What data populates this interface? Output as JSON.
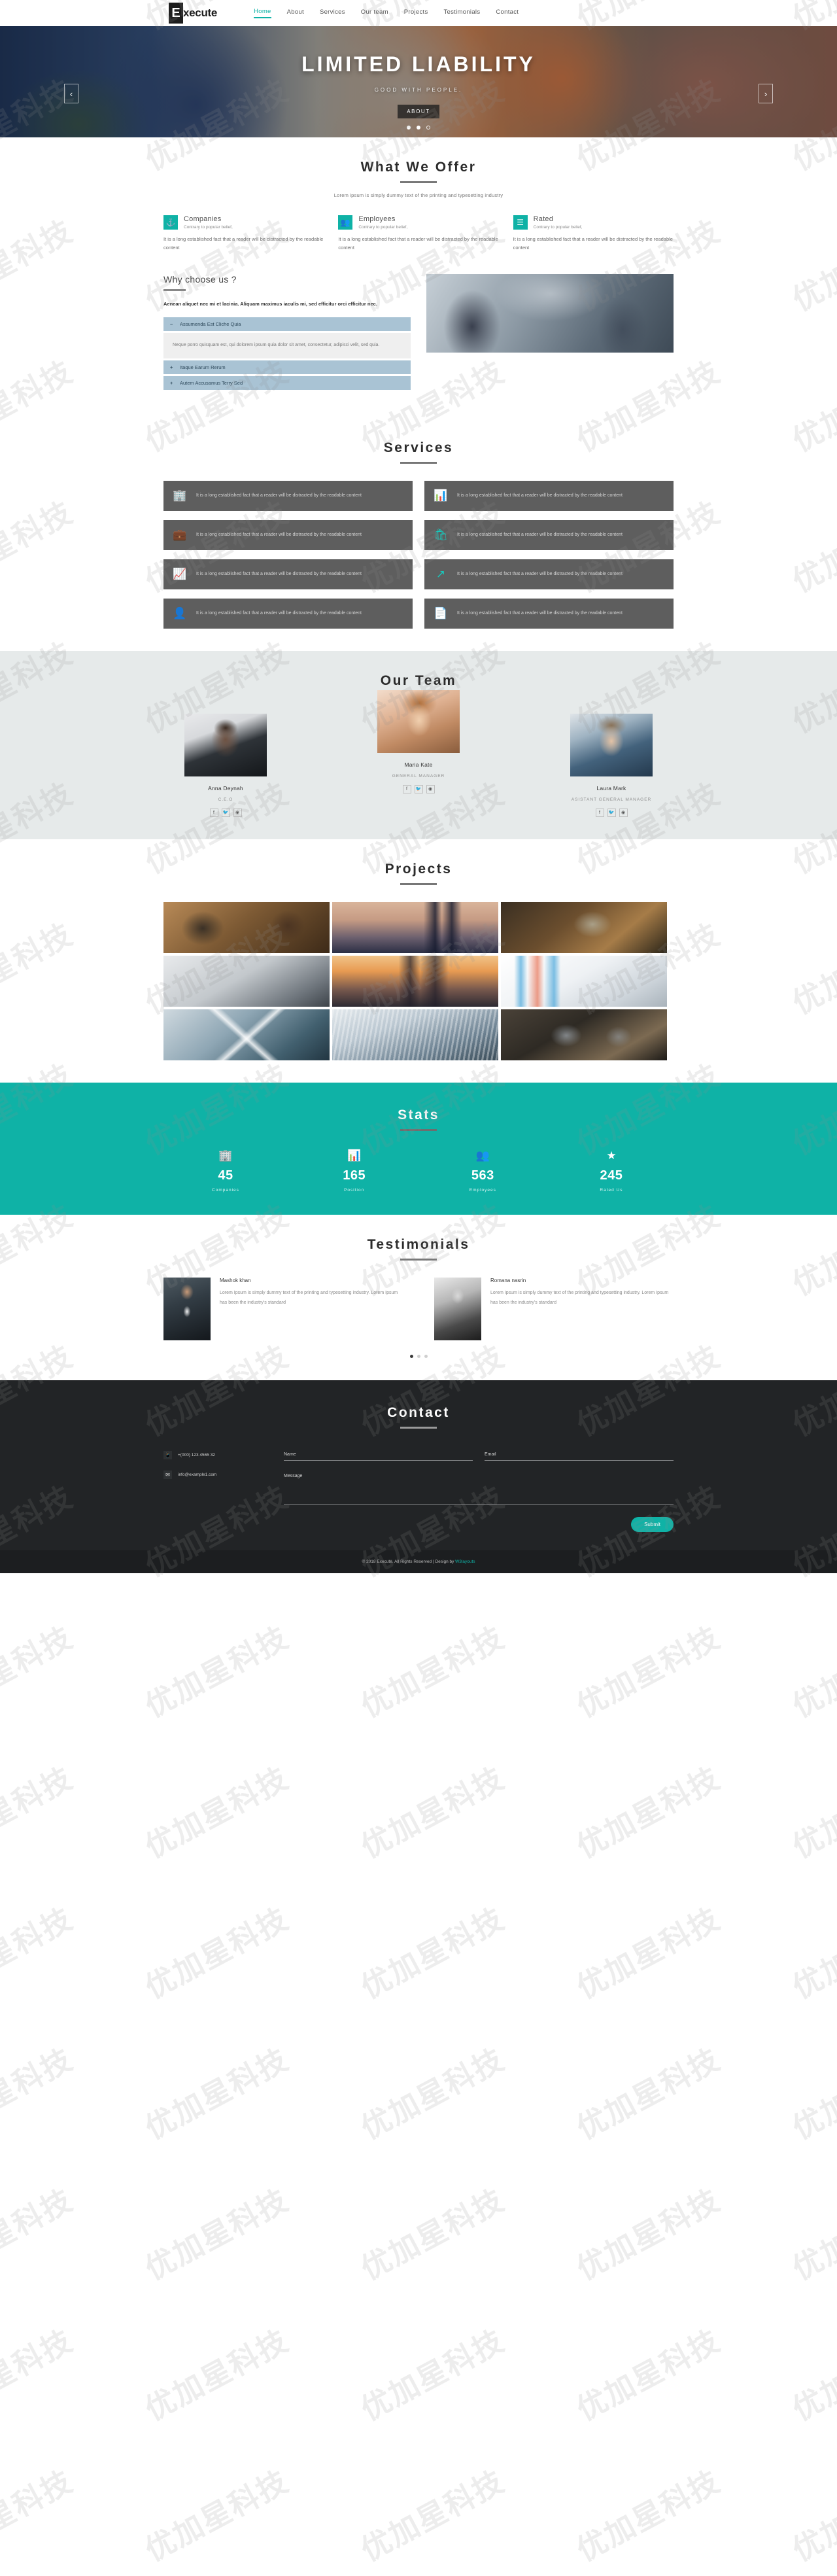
{
  "brand": {
    "logo_letter": "E",
    "logo_rest": "xecute"
  },
  "accent": "#0fb2a6",
  "nav": {
    "items": [
      {
        "label": "Home",
        "active": true
      },
      {
        "label": "About",
        "active": false
      },
      {
        "label": "Services",
        "active": false
      },
      {
        "label": "Our team",
        "active": false
      },
      {
        "label": "Projects",
        "active": false
      },
      {
        "label": "Testimonials",
        "active": false
      },
      {
        "label": "Contact",
        "active": false
      }
    ]
  },
  "hero": {
    "title": "LIMITED LIABILITY",
    "subtitle": "GOOD WITH PEOPLE.",
    "button": "ABOUT",
    "prev_icon": "chevron-left-icon",
    "next_icon": "chevron-right-icon",
    "slides": 3,
    "active_slide": 3
  },
  "offer": {
    "title": "What We Offer",
    "desc": "Lorem ipsum is simply dummy text of the printing and typesetting industry",
    "cards": [
      {
        "icon": "anchor-icon",
        "glyph": "⚓",
        "heading": "Companies",
        "sub": "Contrary to popular belief,",
        "body": "It is a long established fact that a reader will be distracted by the readable content"
      },
      {
        "icon": "users-group-icon",
        "glyph": "὆5",
        "heading": "Employees",
        "sub": "Contrary to popular belief,",
        "body": "It is a long established fact that a reader will be distracted by the readable content"
      },
      {
        "icon": "clipboard-list-icon",
        "glyph": "☰",
        "heading": "Rated",
        "sub": "Contrary to popular belief,",
        "body": "It is a long established fact that a reader will be distracted by the readable content"
      }
    ]
  },
  "why": {
    "title": "Why choose us ?",
    "lead": "Aenean aliquet nec mi et lacinia. Aliquam maximus iaculis mi, sed efficitur orci efficitur nec.",
    "accordion": [
      {
        "sign": "−",
        "label": "Assumenda Est Cliche Quia",
        "open": true,
        "body": "Neque porro quisquam est, qui dolorem ipsum quia dolor sit amet, consectetur, adipisci velit, sed quia."
      },
      {
        "sign": "+",
        "label": "Itaque Earum Rerum",
        "open": false,
        "body": ""
      },
      {
        "sign": "+",
        "label": "Autem Accusamus Terry Sed",
        "open": false,
        "body": ""
      }
    ]
  },
  "services": {
    "title": "Services",
    "cards": [
      {
        "icon": "building-icon",
        "glyph": "Ἶ2",
        "text": "It is a long established fact that a reader will be distracted by the readable content"
      },
      {
        "icon": "bar-chart-icon",
        "glyph": "ὌA",
        "text": "It is a long established fact that a reader will be distracted by the readable content"
      },
      {
        "icon": "briefcase-icon",
        "glyph": "ὋC",
        "text": "It is a long established fact that a reader will be distracted by the readable content"
      },
      {
        "icon": "shopping-bag-icon",
        "glyph": "ὬD",
        "text": "It is a long established fact that a reader will be distracted by the readable content"
      },
      {
        "icon": "line-chart-icon",
        "glyph": "Ὄ8",
        "text": "It is a long established fact that a reader will be distracted by the readable content"
      },
      {
        "icon": "external-link-icon",
        "glyph": "↗",
        "text": "It is a long established fact that a reader will be distracted by the readable content"
      },
      {
        "icon": "user-icon",
        "glyph": "὆4",
        "text": "It is a long established fact that a reader will be distracted by the readable content"
      },
      {
        "icon": "document-icon",
        "glyph": "Ὄ4",
        "text": "It is a long established fact that a reader will be distracted by the readable content"
      }
    ]
  },
  "team": {
    "title": "Our Team",
    "members": [
      {
        "name": "Anna Deynah",
        "role": "C.E.O",
        "socials": [
          "f",
          "ᴠ",
          "@"
        ]
      },
      {
        "name": "Maria Kate",
        "role": "GENERAL MANAGER",
        "socials": [
          "f",
          "ᴠ",
          "@"
        ]
      },
      {
        "name": "Laura Mark",
        "role": "ASISTANT GENERAL MANAGER",
        "socials": [
          "f",
          "ᴠ",
          "@"
        ]
      }
    ]
  },
  "projects": {
    "title": "Projects",
    "items": [
      {
        "alt": "team-working-at-desk"
      },
      {
        "alt": "city-skyline-at-dusk"
      },
      {
        "alt": "office-window-interior"
      },
      {
        "alt": "conference-room-chairs"
      },
      {
        "alt": "skyscrapers-sunset"
      },
      {
        "alt": "analytics-dashboard-screens"
      },
      {
        "alt": "airplane-wings-crossing"
      },
      {
        "alt": "modern-glass-building"
      },
      {
        "alt": "person-at-computer-desk"
      }
    ]
  },
  "stats": {
    "title": "Stats",
    "items": [
      {
        "icon": "building-icon",
        "glyph": "Ἶ2",
        "value": "45",
        "label": "Companies"
      },
      {
        "icon": "bar-chart-icon",
        "glyph": "ὌA",
        "value": "165",
        "label": "Position"
      },
      {
        "icon": "users-group-icon",
        "glyph": "὆5",
        "value": "563",
        "label": "Employees"
      },
      {
        "icon": "star-icon",
        "glyph": "★",
        "value": "245",
        "label": "Rated Us"
      }
    ]
  },
  "testimonials": {
    "title": "Testimonials",
    "items": [
      {
        "name": "Mashok khan",
        "body": "Lorem Ipsum is simply dummy text of the printing and typesetting industry. Lorem Ipsum has been the industry's standard"
      },
      {
        "name": "Romana nasrin",
        "body": "Lorem Ipsum is simply dummy text of the printing and typesetting industry. Lorem Ipsum has been the industry's standard"
      }
    ],
    "dots": 3,
    "active_dot": 1
  },
  "contact": {
    "title": "Contact",
    "phone_icon": "phone-icon",
    "phone": "+(000) 123 4565 32",
    "email_icon": "envelope-icon",
    "email": "info@example1.com",
    "name_placeholder": "Name",
    "email_placeholder": "Email",
    "message_placeholder": "Message",
    "name_value": "",
    "email_value": "",
    "message_value": "",
    "submit_label": "Submit"
  },
  "footer": {
    "text": "© 2018 Execute. All Rights Reserved | Design by ",
    "link": "W3layouts"
  },
  "watermark": {
    "text": "优加星科技"
  }
}
